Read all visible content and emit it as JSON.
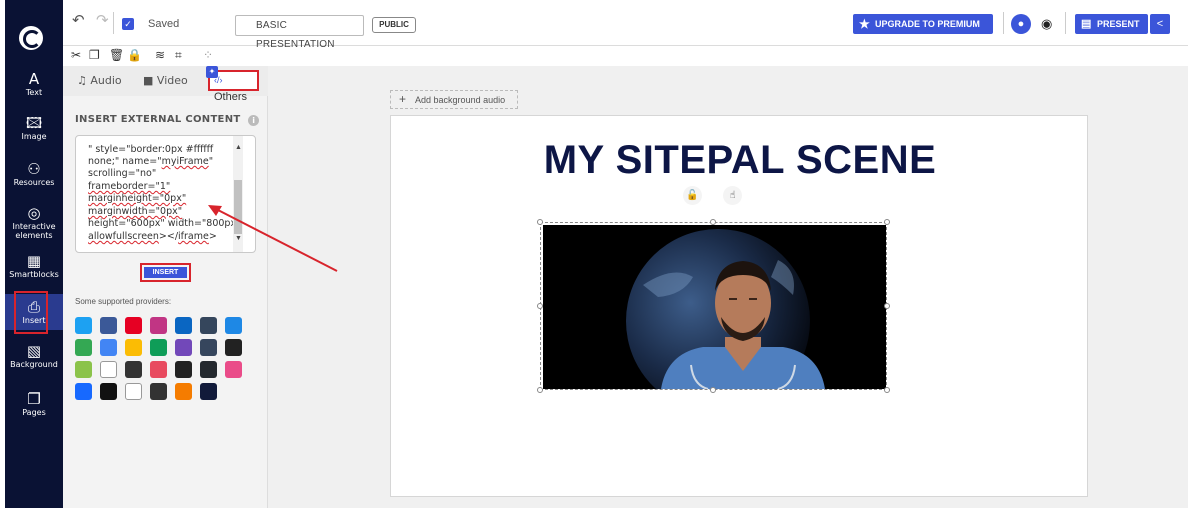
{
  "rail": {
    "items": [
      {
        "label": "Text",
        "icon": "text-icon"
      },
      {
        "label": "Image",
        "icon": "image-icon"
      },
      {
        "label": "Resources",
        "icon": "resources-icon"
      },
      {
        "label": "Interactive elements",
        "icon": "interactive-icon"
      },
      {
        "label": "Smartblocks",
        "icon": "smartblocks-icon"
      },
      {
        "label": "Insert",
        "icon": "insert-icon"
      },
      {
        "label": "Background",
        "icon": "background-icon"
      },
      {
        "label": "Pages",
        "icon": "pages-icon"
      }
    ],
    "active": "Insert"
  },
  "topbar": {
    "saved": "Saved",
    "title": "BASIC PRESENTATION",
    "visibility": "PUBLIC",
    "upgrade": "UPGRADE TO PREMIUM",
    "present": "PRESENT"
  },
  "panel": {
    "tabs": [
      "Audio",
      "Video",
      "Others"
    ],
    "active_tab": "Others",
    "section_title": "INSERT EXTERNAL CONTENT",
    "code_lines": [
      "\" style=\"border:0px #ffffff",
      "none;\" name=\"myiFrame\"",
      "scrolling=\"no\"",
      "frameborder=\"1\"",
      "marginheight=\"0px\"",
      "marginwidth=\"0px\"",
      "height=\"600px\" width=\"800px\"",
      "allowfullscreen></iframe>"
    ],
    "insert_button": "INSERT",
    "providers_label": "Some supported providers:",
    "providers": [
      {
        "name": "twitter",
        "color": "#1da1f2"
      },
      {
        "name": "facebook",
        "color": "#3b5998"
      },
      {
        "name": "pinterest",
        "color": "#e60023"
      },
      {
        "name": "instagram",
        "color": "#c13584"
      },
      {
        "name": "linkedin",
        "color": "#0a66c2"
      },
      {
        "name": "tumblr",
        "color": "#35465c"
      },
      {
        "name": "blogger-style",
        "color": "#1e88e5"
      },
      {
        "name": "google-maps",
        "color": "#34a853"
      },
      {
        "name": "google-docs",
        "color": "#4285f4"
      },
      {
        "name": "google-drive",
        "color": "#fbbc04"
      },
      {
        "name": "google-sheets",
        "color": "#0f9d58"
      },
      {
        "name": "google-forms",
        "color": "#7248b9"
      },
      {
        "name": "tumblr-t",
        "color": "#36465d"
      },
      {
        "name": "quora-style",
        "color": "#222222"
      },
      {
        "name": "stats",
        "color": "#8bc34a"
      },
      {
        "name": "wikipedia",
        "color": "#ffffff"
      },
      {
        "name": "cube",
        "color": "#333333"
      },
      {
        "name": "dots",
        "color": "#e84a5f"
      },
      {
        "name": "codepen",
        "color": "#222222"
      },
      {
        "name": "github",
        "color": "#24292e"
      },
      {
        "name": "dribbble",
        "color": "#ea4c89"
      },
      {
        "name": "behance",
        "color": "#1769ff"
      },
      {
        "name": "flickr",
        "color": "#111111"
      },
      {
        "name": "amazon",
        "color": "#ffffff"
      },
      {
        "name": "streamable",
        "color": "#333333"
      },
      {
        "name": "diamond",
        "color": "#f57c00"
      },
      {
        "name": "genially",
        "color": "#111a3a"
      }
    ]
  },
  "canvas": {
    "add_audio": "Add background audio",
    "scene_title": "MY SITEPAL SCENE"
  },
  "colors": {
    "rail_bg": "#0a1234",
    "accent": "#3b55d9",
    "highlight": "#d8242c",
    "title": "#0d1646"
  }
}
